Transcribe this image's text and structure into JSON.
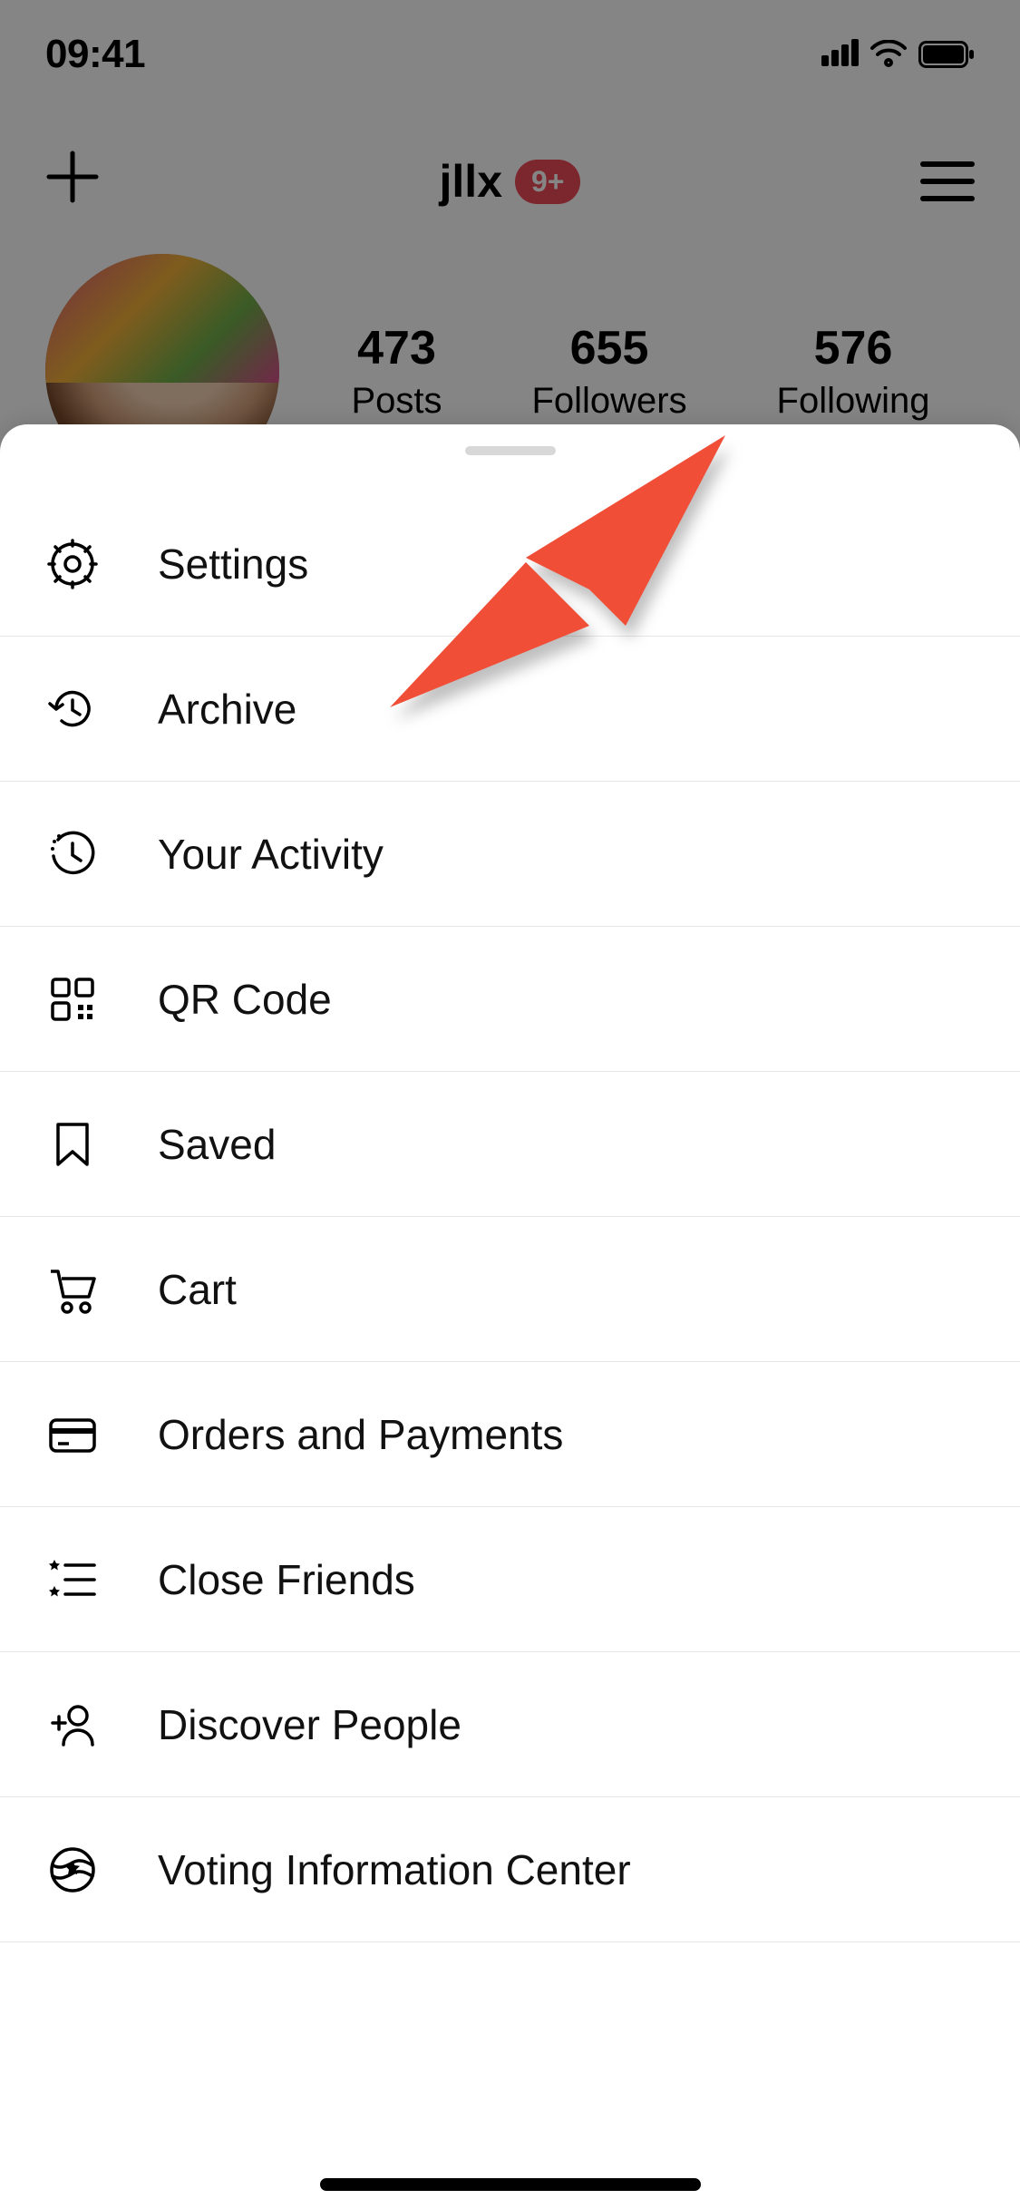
{
  "status": {
    "time": "09:41"
  },
  "header": {
    "username": "jllx",
    "badge": "9+"
  },
  "stats": {
    "posts": {
      "value": "473",
      "label": "Posts"
    },
    "followers": {
      "value": "655",
      "label": "Followers"
    },
    "following": {
      "value": "576",
      "label": "Following"
    }
  },
  "menu": {
    "items": [
      {
        "icon": "gear-icon",
        "label": "Settings"
      },
      {
        "icon": "clock-back-icon",
        "label": "Archive"
      },
      {
        "icon": "activity-icon",
        "label": "Your Activity"
      },
      {
        "icon": "qr-icon",
        "label": "QR Code"
      },
      {
        "icon": "bookmark-icon",
        "label": "Saved"
      },
      {
        "icon": "cart-icon",
        "label": "Cart"
      },
      {
        "icon": "card-icon",
        "label": "Orders and Payments"
      },
      {
        "icon": "star-list-icon",
        "label": "Close Friends"
      },
      {
        "icon": "add-person-icon",
        "label": "Discover People"
      },
      {
        "icon": "vote-badge-icon",
        "label": "Voting Information Center"
      }
    ]
  },
  "annotation": {
    "target_index": 2,
    "color": "#f04e37"
  }
}
